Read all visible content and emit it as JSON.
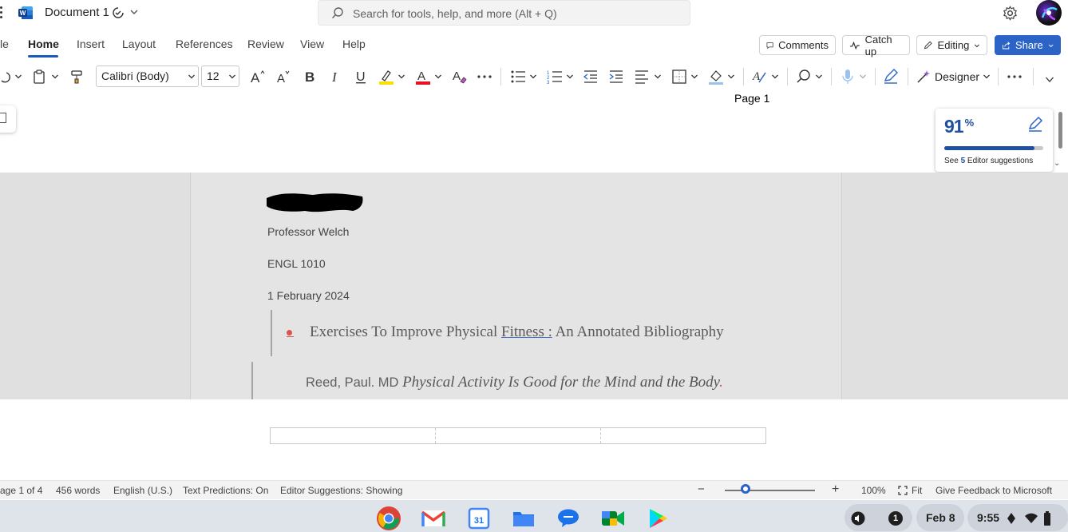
{
  "titlebar": {
    "app_icon": "word-icon",
    "document_title": "Document 1",
    "search_placeholder": "Search for tools, help, and more (Alt + Q)"
  },
  "tabs": [
    {
      "label": "le",
      "active": false
    },
    {
      "label": "Home",
      "active": true
    },
    {
      "label": "Insert",
      "active": false
    },
    {
      "label": "Layout",
      "active": false
    },
    {
      "label": "References",
      "active": false
    },
    {
      "label": "Review",
      "active": false
    },
    {
      "label": "View",
      "active": false
    },
    {
      "label": "Help",
      "active": false
    }
  ],
  "tab_actions": {
    "comments": "Comments",
    "catch_up": "Catch up",
    "editing": "Editing",
    "share": "Share"
  },
  "ribbon": {
    "font_name": "Calibri (Body)",
    "font_size": "12",
    "designer": "Designer"
  },
  "canvas": {
    "page_label": "Page 1"
  },
  "document": {
    "professor": "Professor Welch",
    "course": "ENGL 1010",
    "date": "1 February 2024",
    "heading_part1": "Exercises To Improve Physical ",
    "heading_fitness": "Fitness :",
    "heading_part2": " An Annotated Bibliography",
    "citation_author": "Reed, Paul. MD ",
    "citation_title": "Physical Activity Is Good for the Mind and the Body",
    "citation_end": "."
  },
  "editor_panel": {
    "score": "91",
    "score_unit": "%",
    "score_fraction": 0.91,
    "see": "See ",
    "count": "5",
    "suggestions": " Editor suggestions"
  },
  "status_bar": {
    "page": "age 1 of 4",
    "words": "456 words",
    "language": "English (U.S.)",
    "text_predictions": "Text Predictions: On",
    "editor_suggestions": "Editor Suggestions: Showing",
    "zoom_out": "−",
    "zoom_in": "+",
    "zoom": "100%",
    "fit": "Fit",
    "feedback": "Give Feedback to Microsoft"
  },
  "shelf": {
    "apps": [
      "chrome-icon",
      "gmail-icon",
      "calendar-icon",
      "files-icon",
      "chat-icon",
      "meet-icon",
      "play-store-icon"
    ],
    "calendar_day": "31",
    "notification_count": "1",
    "date": "Feb 8",
    "time": "9:55"
  },
  "colors": {
    "accent": "#185abd",
    "share": "#2b63c7",
    "editor_score": "#1f4fa0",
    "canvas_gray": "#e0e0e0"
  }
}
